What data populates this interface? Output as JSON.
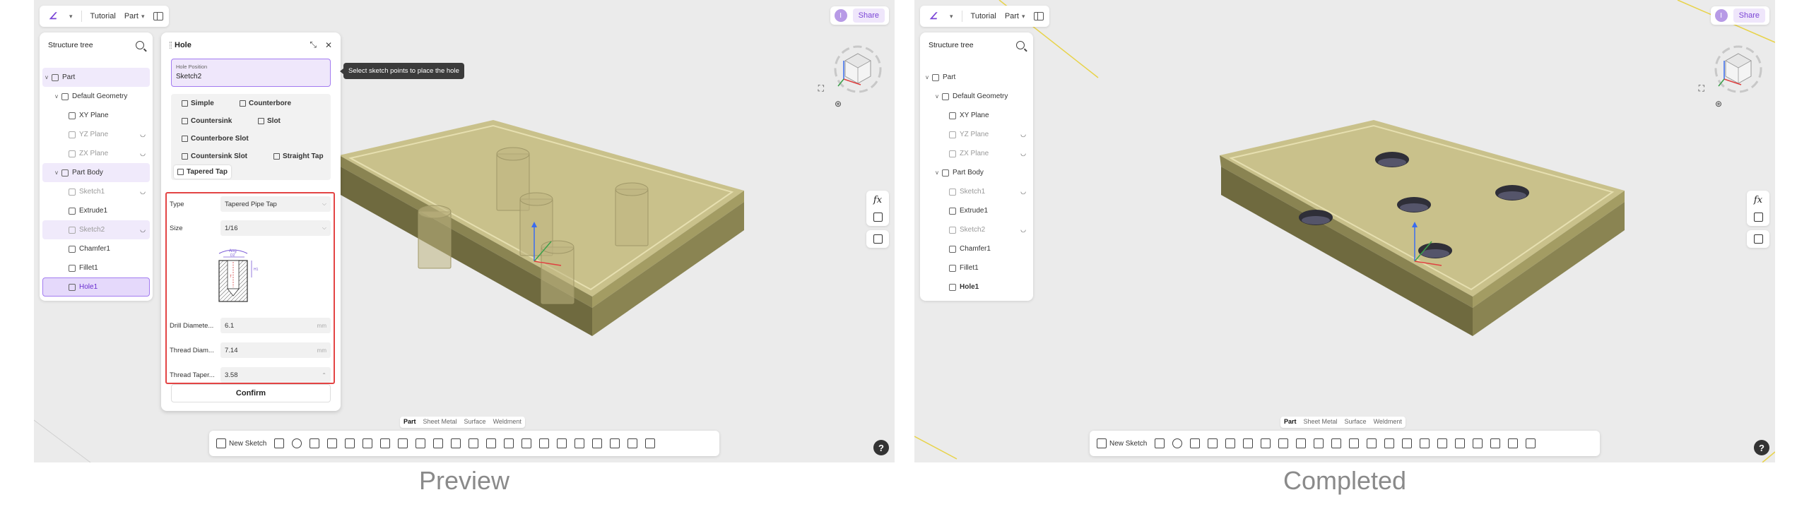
{
  "captions": {
    "left": "Preview",
    "right": "Completed"
  },
  "topbar": {
    "breadcrumb_tutorial": "Tutorial",
    "breadcrumb_part": "Part"
  },
  "share": {
    "avatar_letter": "I",
    "label": "Share"
  },
  "tree": {
    "title": "Structure tree",
    "items": [
      {
        "label": "Part",
        "indent": 0,
        "toggle": "v",
        "icon": "part-icon"
      },
      {
        "label": "Default Geometry",
        "indent": 1,
        "toggle": "v",
        "icon": "geometry-icon"
      },
      {
        "label": "XY Plane",
        "indent": 2,
        "icon": "plane-icon"
      },
      {
        "label": "YZ Plane",
        "indent": 2,
        "icon": "plane-icon",
        "dim": true,
        "hidden": true
      },
      {
        "label": "ZX Plane",
        "indent": 2,
        "icon": "plane-icon",
        "dim": true,
        "hidden": true
      },
      {
        "label": "Part Body",
        "indent": 1,
        "toggle": "v",
        "icon": "body-icon"
      },
      {
        "label": "Sketch1",
        "indent": 2,
        "icon": "sketch-icon",
        "dim": true,
        "hidden": true
      },
      {
        "label": "Extrude1",
        "indent": 2,
        "icon": "extrude-icon"
      },
      {
        "label": "Sketch2",
        "indent": 2,
        "icon": "sketch-icon",
        "dim": true,
        "hidden": true
      },
      {
        "label": "Chamfer1",
        "indent": 2,
        "icon": "chamfer-icon"
      },
      {
        "label": "Fillet1",
        "indent": 2,
        "icon": "fillet-icon"
      },
      {
        "label": "Hole1",
        "indent": 2,
        "icon": "hole-icon"
      }
    ]
  },
  "hole_dialog": {
    "title": "Hole",
    "position_caption": "Hole Position",
    "position_value": "Sketch2",
    "tooltip": "Select sketch points to place the hole",
    "types": [
      "Simple",
      "Counterbore",
      "Countersink",
      "Slot",
      "Counterbore Slot",
      "Countersink Slot",
      "Straight Tap",
      "Tapered Tap"
    ],
    "active_type": "Tapered Tap",
    "params": {
      "type_label": "Type",
      "type_value": "Tapered Pipe Tap",
      "size_label": "Size",
      "size_value": "1/16",
      "drill_label": "Drill Diamete...",
      "drill_value": "6.1",
      "drill_unit": "mm",
      "thread_label": "Thread Diam...",
      "thread_value": "7.14",
      "thread_unit": "mm",
      "taper_label": "Thread Taper...",
      "taper_value": "3.58"
    },
    "diagram": {
      "angle_label": "Ang",
      "dia_label": "D2",
      "depth_label": "H1",
      "thread_label": "T"
    },
    "confirm": "Confirm"
  },
  "modes": {
    "part": "Part",
    "sheet_metal": "Sheet Metal",
    "surface": "Surface",
    "weldment": "Weldment"
  },
  "toolbar": {
    "new_sketch": "New Sketch"
  },
  "tools": {
    "fx": "fx"
  },
  "help": "?",
  "colors": {
    "accent": "#7a44d6",
    "highlight": "#e34444",
    "part_top": "#c9c18b",
    "part_side": "#8a8452"
  }
}
